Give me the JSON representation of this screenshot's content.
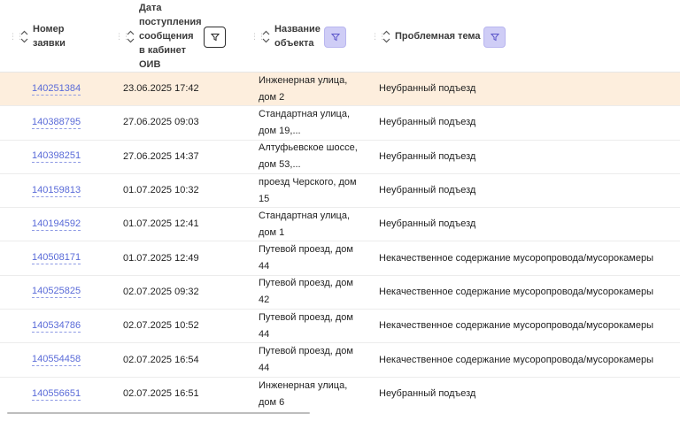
{
  "columns": {
    "id": "Номер\nзаявки",
    "date": "Дата\nпоступления\nсообщения\nв кабинет\nОИВ",
    "object": "Название\nобъекта",
    "topic": "Проблемная тема"
  },
  "icons": {
    "drag": "drag-handle-icon",
    "sort": "sort-arrows-icon",
    "filter": "filter-funnel-icon"
  },
  "colors": {
    "link": "#5a6bd8",
    "highlight_row": "#fdeedd",
    "active_filter": "#cfcdf6"
  },
  "rows": [
    {
      "id": "140251384",
      "date": "23.06.2025 17:42",
      "object": "Инженерная улица, дом 2",
      "topic": "Неубранный подъезд",
      "highlight": true
    },
    {
      "id": "140388795",
      "date": "27.06.2025 09:03",
      "object": "Стандартная улица, дом 19,...",
      "topic": "Неубранный подъезд"
    },
    {
      "id": "140398251",
      "date": "27.06.2025 14:37",
      "object": "Алтуфьевское шоссе, дом 53,...",
      "topic": "Неубранный подъезд"
    },
    {
      "id": "140159813",
      "date": "01.07.2025 10:32",
      "object": "проезд Черского, дом 15",
      "topic": "Неубранный подъезд"
    },
    {
      "id": "140194592",
      "date": "01.07.2025 12:41",
      "object": "Стандартная улица, дом 1",
      "topic": "Неубранный подъезд"
    },
    {
      "id": "140508171",
      "date": "01.07.2025 12:49",
      "object": "Путевой проезд, дом 44",
      "topic": "Некачественное содержание мусоропровода/мусорокамеры"
    },
    {
      "id": "140525825",
      "date": "02.07.2025 09:32",
      "object": "Путевой проезд, дом 42",
      "topic": "Некачественное содержание мусоропровода/мусорокамеры"
    },
    {
      "id": "140534786",
      "date": "02.07.2025 10:52",
      "object": "Путевой проезд, дом 44",
      "topic": "Некачественное содержание мусоропровода/мусорокамеры"
    },
    {
      "id": "140554458",
      "date": "02.07.2025 16:54",
      "object": "Путевой проезд, дом 44",
      "topic": "Некачественное содержание мусоропровода/мусорокамеры"
    },
    {
      "id": "140556651",
      "date": "02.07.2025 16:51",
      "object": "Инженерная улица, дом 6",
      "topic": "Неубранный подъезд"
    }
  ]
}
